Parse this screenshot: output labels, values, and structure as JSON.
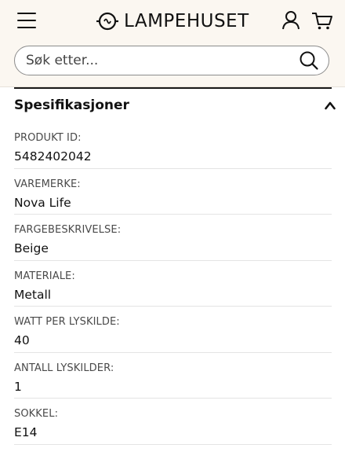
{
  "header": {
    "logo_text": "LAMPEHUSET",
    "icons": {
      "menu": "hamburger-menu-icon",
      "logo": "lightbulb-logo-icon",
      "user": "user-icon",
      "cart": "shopping-cart-icon",
      "search": "search-icon"
    }
  },
  "search": {
    "placeholder": "Søk etter...",
    "value": ""
  },
  "specifications": {
    "title": "Spesifikasjoner",
    "expanded": true,
    "items": [
      {
        "label": "PRODUKT ID:",
        "value": "5482402042"
      },
      {
        "label": "VAREMERKE:",
        "value": "Nova Life"
      },
      {
        "label": "FARGEBESKRIVELSE:",
        "value": "Beige"
      },
      {
        "label": "MATERIALE:",
        "value": "Metall"
      },
      {
        "label": "WATT PER LYSKILDE:",
        "value": "40"
      },
      {
        "label": "ANTALL LYSKILDER:",
        "value": "1"
      },
      {
        "label": "SOKKEL:",
        "value": "E14"
      }
    ]
  },
  "colors": {
    "header_bg": "#fbf7f1",
    "text": "#111111",
    "label": "#4a4a4a",
    "divider": "#e4e4e4"
  }
}
